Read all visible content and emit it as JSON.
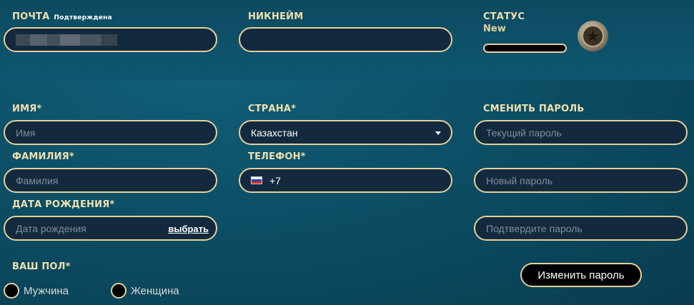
{
  "email": {
    "label": "Почта",
    "status": "Подтверждена",
    "value": ""
  },
  "nickname": {
    "label": "Никнейм",
    "value": ""
  },
  "status": {
    "label": "Статус",
    "value": "New",
    "progress": 0.0
  },
  "first_name": {
    "label": "Имя*",
    "placeholder": "Имя"
  },
  "last_name": {
    "label": "Фамилия*",
    "placeholder": "Фамилия"
  },
  "birth_date": {
    "label": "Дата рождения*",
    "placeholder": "Дата рождения",
    "pick_label": "выбрать"
  },
  "country": {
    "label": "Страна*",
    "value": "Казахстан"
  },
  "phone": {
    "label": "Телефон*",
    "value": "+7"
  },
  "password": {
    "label": "Сменить пароль",
    "current_placeholder": "Текущий пароль",
    "new_placeholder": "Новый пароль",
    "confirm_placeholder": "Подтвердите пароль",
    "button_label": "Изменить пароль"
  },
  "gender": {
    "label": "Ваш пол*",
    "options": [
      "Мужчина",
      "Женщина"
    ]
  },
  "colors": {
    "accent": "#e6d09a",
    "field_bg": "#132a3e",
    "label": "#f0dfae"
  }
}
